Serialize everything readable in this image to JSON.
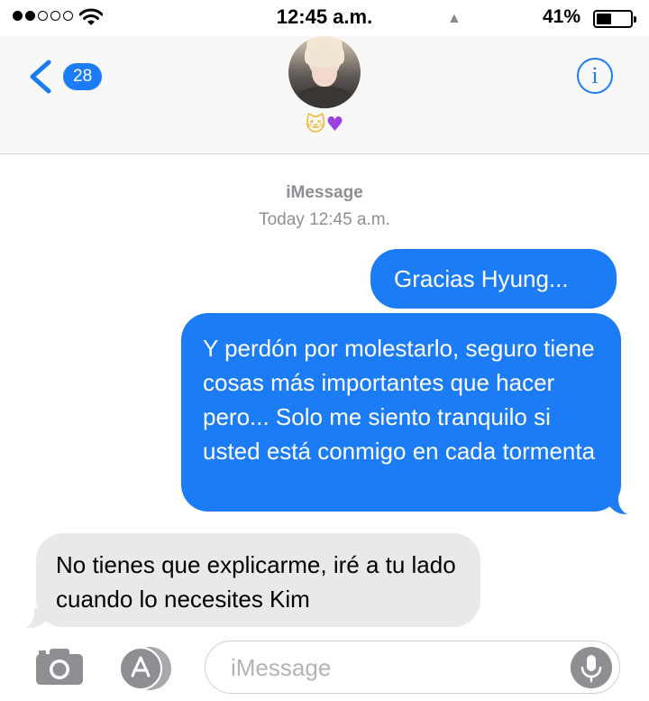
{
  "status_bar": {
    "time": "12:45 a.m.",
    "battery_percent": "41%",
    "signal_bars_filled": 2,
    "signal_bars_total": 5
  },
  "header": {
    "back_badge": "28",
    "contact_emoji": [
      "cat-face",
      "purple-heart"
    ],
    "info_icon": "info-icon"
  },
  "conversation": {
    "service": "iMessage",
    "timestamp": "Today 12:45 a.m.",
    "messages": [
      {
        "sender": "me",
        "text": "Gracias Hyung..."
      },
      {
        "sender": "me",
        "text": "Y perdón por molestarlo, seguro tiene cosas más importantes que hacer pero... Solo me siento tranquilo si usted está conmigo en cada tormenta"
      },
      {
        "sender": "contact",
        "text": "No tienes que explicarme, iré a tu lado cuando lo necesites Kim"
      }
    ]
  },
  "input_bar": {
    "placeholder": "iMessage",
    "icons": [
      "camera-icon",
      "app-store-icon",
      "microphone-icon"
    ]
  },
  "colors": {
    "accent": "#1b7cf5",
    "received_bubble": "#e9e9eb",
    "secondary_text": "#8e8e93"
  }
}
